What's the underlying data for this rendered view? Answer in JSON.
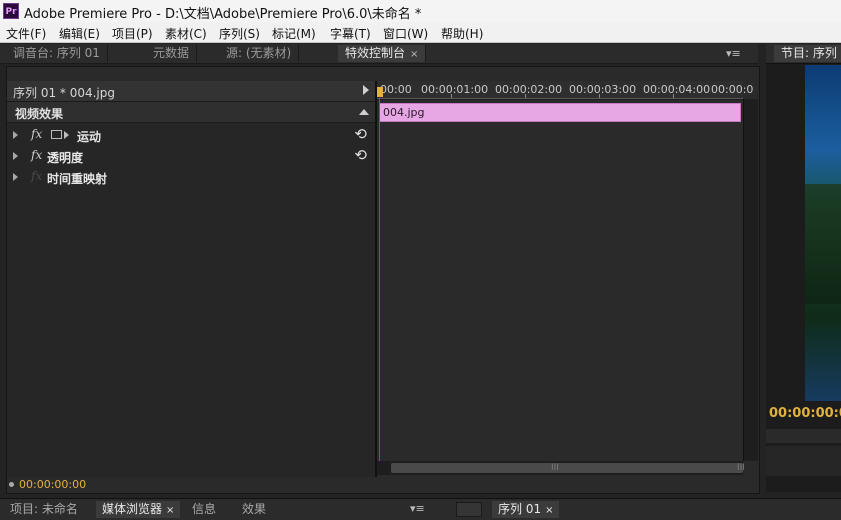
{
  "window": {
    "app_icon": "Pr",
    "title": "Adobe Premiere Pro - D:\\文档\\Adobe\\Premiere Pro\\6.0\\未命名 *"
  },
  "menu": [
    {
      "label": "文件(F)"
    },
    {
      "label": "编辑(E)"
    },
    {
      "label": "项目(P)"
    },
    {
      "label": "素材(C)"
    },
    {
      "label": "序列(S)"
    },
    {
      "label": "标记(M)"
    },
    {
      "label": "字幕(T)"
    },
    {
      "label": "窗口(W)"
    },
    {
      "label": "帮助(H)"
    }
  ],
  "top_tabs": [
    {
      "label": "调音台: 序列 01"
    },
    {
      "label": "元数据"
    },
    {
      "label": "源: (无素材)"
    },
    {
      "label": "特效控制台"
    }
  ],
  "panel_menu_glyph": "▾≡",
  "effect_controls": {
    "clip_header": "序列 01 * 004.jpg",
    "video_effects_label": "视频效果",
    "effects": [
      {
        "fx": "fx",
        "name": "运动"
      },
      {
        "fx": "fx",
        "name": "透明度"
      },
      {
        "fx": "fx",
        "name": "时间重映射"
      }
    ],
    "reset_glyph": "⟲",
    "ruler_labels": [
      "00:00",
      "00:00:01:00",
      "00:00:02:00",
      "00:00:03:00",
      "00:00:04:00",
      "00:00:0"
    ],
    "clip_name": "004.jpg",
    "current_time": "00:00:00:00",
    "scroll_grip": "III"
  },
  "program_monitor": {
    "tab_label": "节目: 序列",
    "timecode": "00:00:00:0"
  },
  "bottom_tabs": [
    {
      "label": "项目: 未命名"
    },
    {
      "label": "媒体浏览器"
    },
    {
      "label": "信息"
    },
    {
      "label": "效果"
    },
    {
      "label": "序列 01"
    }
  ],
  "close_glyph": "×",
  "colors": {
    "accent_timecode": "#e3b23c",
    "clip_bar": "#e7a6e4",
    "playhead": "#c0392b"
  }
}
